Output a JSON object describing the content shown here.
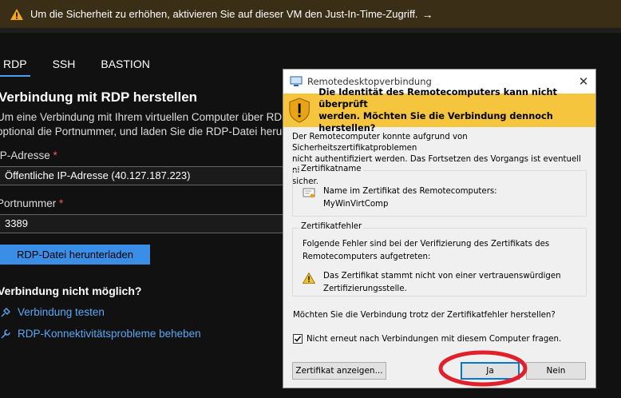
{
  "banner": {
    "text": "Um die Sicherheit zu erhöhen, aktivieren Sie auf dieser VM den Just-In-Time-Zugriff.",
    "arrow": "→",
    "icon": "warning-icon"
  },
  "tabs": [
    {
      "label": "RDP",
      "active": true
    },
    {
      "label": "SSH",
      "active": false
    },
    {
      "label": "BASTION",
      "active": false
    }
  ],
  "section": {
    "title": "Verbindung mit RDP herstellen",
    "description_line1": "Um eine Verbindung mit Ihrem virtuellen Computer über RDP",
    "description_line2": "optional die Portnummer, und laden Sie die RDP-Datei herunter."
  },
  "ip_field": {
    "label": "IP-Adresse",
    "required_mark": "*",
    "value": "Öffentliche IP-Adresse (40.127.187.223)"
  },
  "port_field": {
    "label": "Portnummer",
    "required_mark": "*",
    "value": "3389"
  },
  "download_button": "RDP-Datei herunterladen",
  "troubleshoot": {
    "title": "Verbindung nicht möglich?",
    "links": [
      {
        "label": "Verbindung testen",
        "icon": "plug-icon"
      },
      {
        "label": "RDP-Konnektivitätsprobleme beheben",
        "icon": "wrench-icon"
      }
    ]
  },
  "dialog": {
    "title": "Remotedesktopverbindung",
    "close": "✕",
    "warning_line1": "Die Identität des Remotecomputers kann nicht überprüft",
    "warning_line2": "werden. Möchten Sie die Verbindung dennoch herstellen?",
    "body_line1": "Der Remotecomputer konnte aufgrund von Sicherheitszertifikatproblemen",
    "body_line2": "nicht authentifiziert werden. Das Fortsetzen des Vorgangs ist eventuell nicht",
    "body_line3": "sicher.",
    "cert_name_group": {
      "title": "Zertifikatname",
      "line1": "Name im Zertifikat des Remotecomputers:",
      "line2": "MyWinVirtComp"
    },
    "cert_error_group": {
      "title": "Zertifikatfehler",
      "line1": "Folgende Fehler sind bei der Verifizierung des Zertifikats des",
      "line2": "Remotecomputers aufgetreten:",
      "error_line1": "Das Zertifikat stammt nicht von einer vertrauenswürdigen",
      "error_line2": "Zertifizierungsstelle."
    },
    "question": "Möchten Sie die Verbindung trotz der Zertifikatfehler herstellen?",
    "checkbox_label": "Nicht erneut nach Verbindungen mit diesem Computer fragen.",
    "checkbox_checked": true,
    "buttons": {
      "view_cert": "Zertifikat anzeigen...",
      "yes": "Ja",
      "no": "Nein"
    }
  },
  "colors": {
    "accent": "#3a8ee6",
    "warning_bar": "#f6c53e",
    "annotation": "#e0202a"
  }
}
